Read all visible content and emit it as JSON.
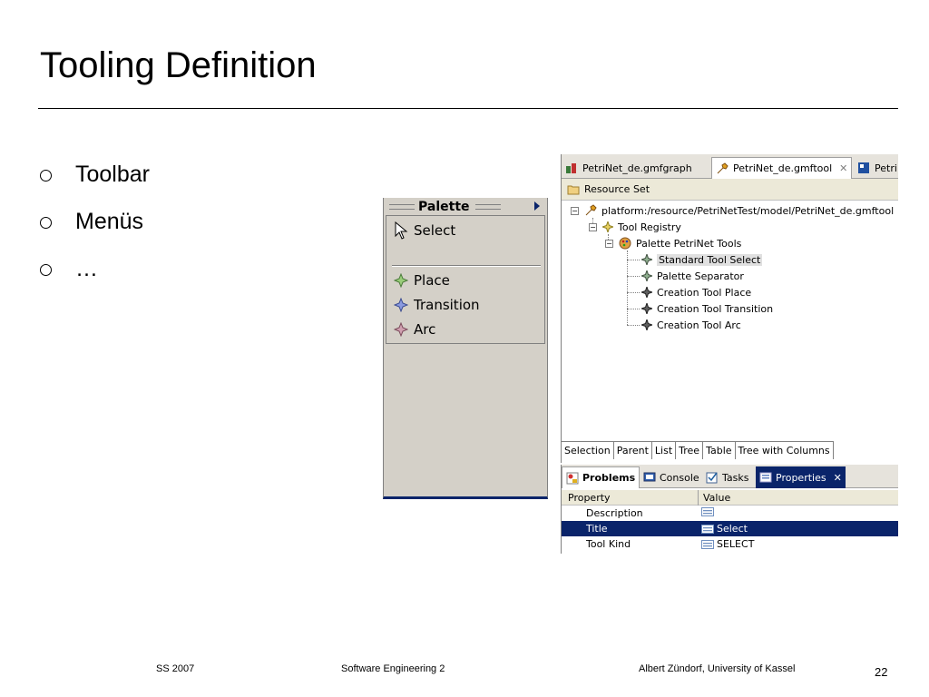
{
  "slide": {
    "title": "Tooling Definition",
    "bullets": [
      "Toolbar",
      "Menüs",
      "…"
    ]
  },
  "palette": {
    "title": "Palette",
    "items": [
      {
        "label": "Select",
        "icon": "cursor-arrow-icon"
      },
      {
        "label": "Place",
        "icon": "tool-place-icon"
      },
      {
        "label": "Transition",
        "icon": "tool-transition-icon"
      },
      {
        "label": "Arc",
        "icon": "tool-arc-icon"
      }
    ]
  },
  "editor": {
    "tabs": [
      {
        "label": "PetriNet_de.gmfgraph",
        "icon": "gmfgraph-icon"
      },
      {
        "label": "PetriNet_de.gmftool",
        "icon": "gmftool-icon",
        "active": true
      },
      {
        "label": "Petri",
        "icon": "diagram-icon"
      }
    ],
    "resource_set": "Resource Set",
    "tree": {
      "root": "platform:/resource/PetriNetTest/model/PetriNet_de.gmftool",
      "registry": "Tool Registry",
      "palette": "Palette PetriNet Tools",
      "children": [
        "Standard Tool Select",
        "Palette Separator",
        "Creation Tool Place",
        "Creation Tool Transition",
        "Creation Tool Arc"
      ],
      "selected_child": "Standard Tool Select"
    },
    "bottom_tabs": [
      "Selection",
      "Parent",
      "List",
      "Tree",
      "Table",
      "Tree with Columns"
    ]
  },
  "properties": {
    "tabs": [
      {
        "label": "Problems",
        "icon": "problems-icon"
      },
      {
        "label": "Console",
        "icon": "console-icon"
      },
      {
        "label": "Tasks",
        "icon": "tasks-icon"
      },
      {
        "label": "Properties",
        "icon": "properties-icon",
        "active": true
      }
    ],
    "columns": [
      "Property",
      "Value"
    ],
    "rows": [
      {
        "property": "Description",
        "value": ""
      },
      {
        "property": "Title",
        "value": "Select",
        "selected": true
      },
      {
        "property": "Tool Kind",
        "value": "SELECT"
      }
    ]
  },
  "footer": {
    "term": "SS 2007",
    "course": "Software Engineering 2",
    "author": "Albert Zündorf, University of Kassel",
    "page": "22"
  },
  "colors": {
    "selection": "#0a246a",
    "panel": "#d4d0c8"
  }
}
